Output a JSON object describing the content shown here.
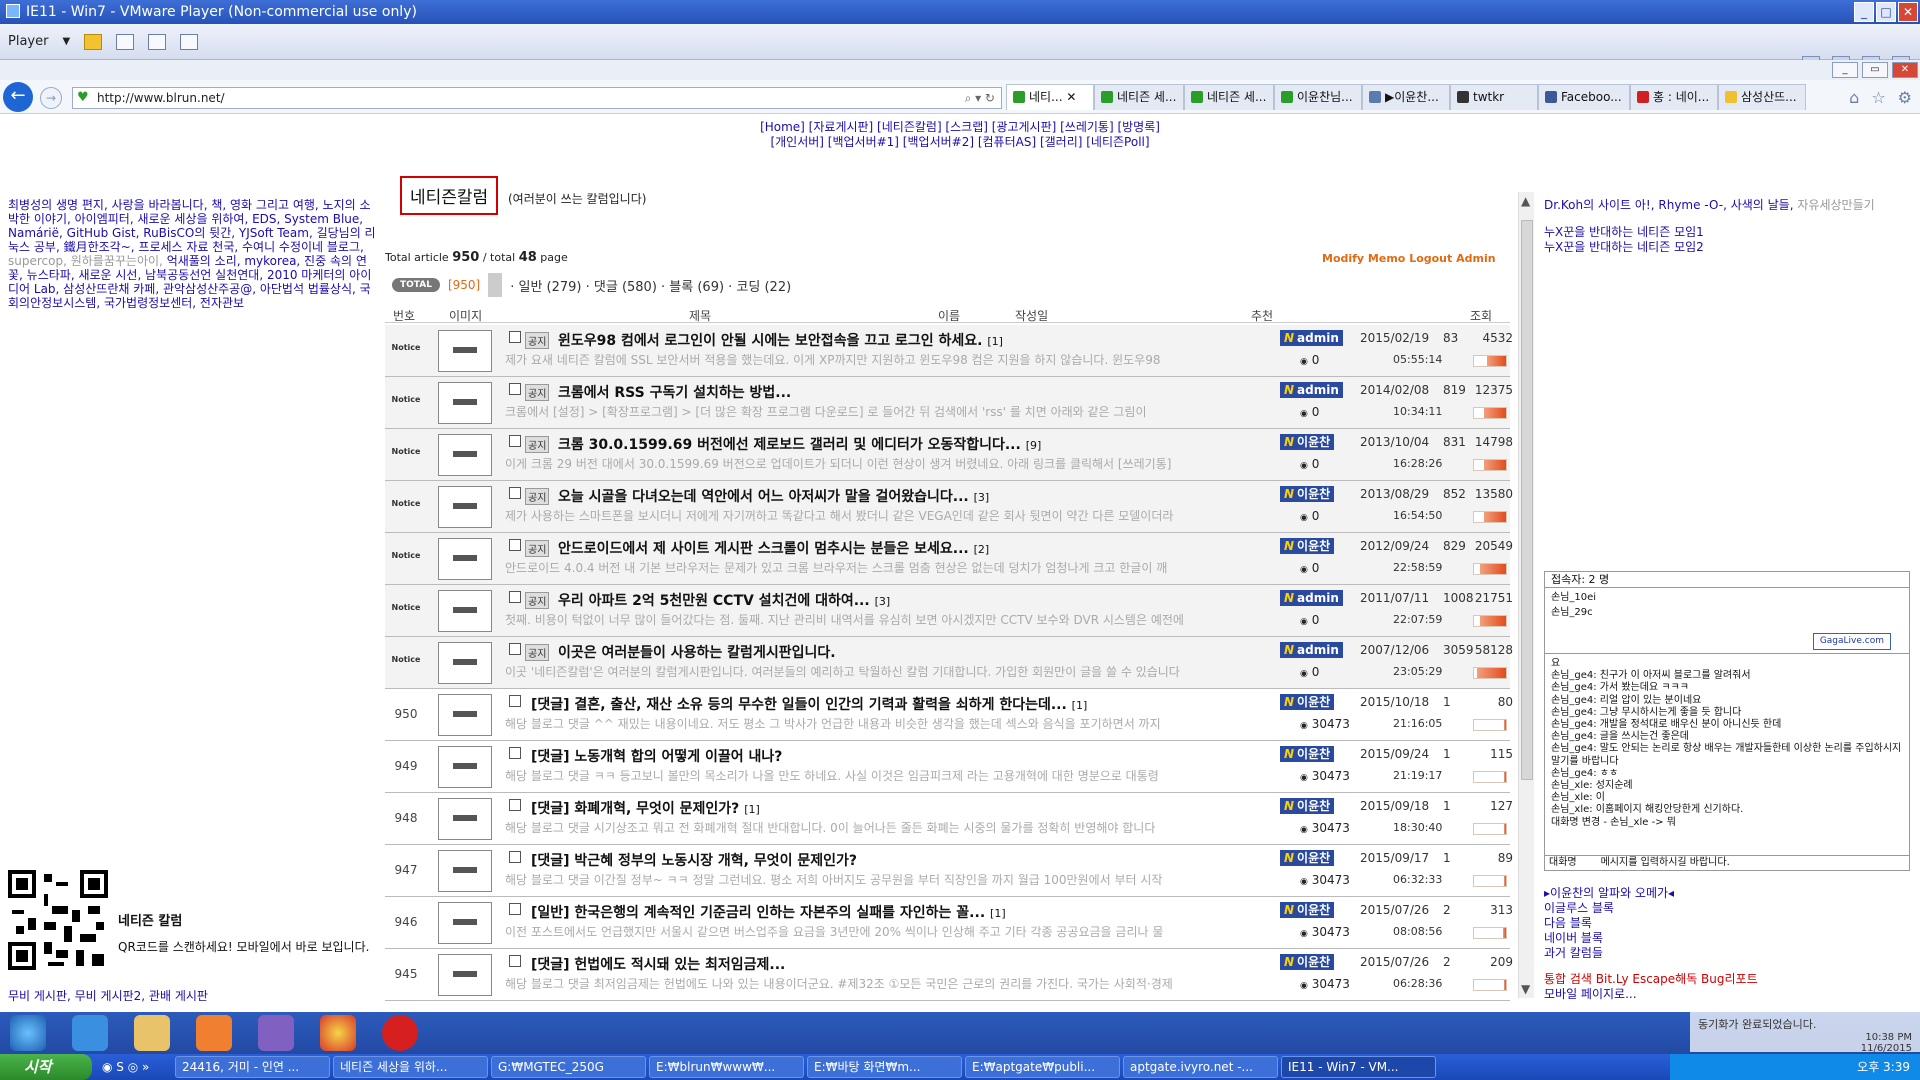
{
  "window": {
    "title": "IE11 - Win7 - VMware Player (Non-commercial use only)"
  },
  "vm_toolbar": {
    "player_label": "Player"
  },
  "browser": {
    "url": "http://www.blrun.net/",
    "tabs": [
      "네티...",
      "네티즌 세...",
      "네티즌 세...",
      "이윤찬님...",
      "▶이윤찬...",
      "twtkr",
      "Faceboo...",
      "홍 : 네이...",
      "삼성산뜨..."
    ]
  },
  "topmenu": {
    "line1": "[Home] [자료게시판] [네티즌칼럼] [스크랩] [광고게시판] [쓰레기통] [방명록]",
    "line2": "[개인서버] [백업서버#1] [백업서버#2] [컴퓨터AS] [갤러리] [네티즌Poll]"
  },
  "left_links": "최병성의 생명 편지, 사랑을 바라봅니다, 책, 영화 그리고 여행, 노지의 소박한 이야기, 아이엠피터, 새로운 세상을 위하여, EDS, System Blue, Namárië, GitHub Gist, RuBisCO의 뒷간, YJSoft Team, 길당님의 리눅스 공부, 鐵月한조각~, 프로세스 자료 천국, 수여니 수정이네 블로그,",
  "left_links_gray": "supercop, 원하를꿈꾸는아이,",
  "left_links2": "억새풀의 소리, mykorea, 진중 속의 연꽃, 뉴스타파, 새로운 시선, 남북공동선언 실천연대, 2010 마케터의 아이디어 Lab, 삼성산뜨란채 카페, 관악삼성산주공@, 아단법석 법률상식, 국회의안정보시스템, 국가법령정보센터, 전자관보",
  "qr": {
    "title": "네티즌 칼럼",
    "desc": "QR코드를 스캔하세요! 모바일에서 바로 보입니다.",
    "links": "무비 게시판, 무비 게시판2, 관배 게시판"
  },
  "board": {
    "title": "네티즌칼럼",
    "subtitle": "(여러분이 쓰는 칼럼입니다)",
    "total_label": "Total article",
    "total_articles": "950",
    "total_pages_label": "/ total",
    "total_pages": "48",
    "page_word": "page",
    "admin_links": "Modify  Memo  Logout  Admin",
    "filter_badge": "TOTAL",
    "filter_count": "[950]",
    "filters": "· 일반 (279)  · 댓글 (580)  · 블록 (69)  · 코딩 (22)",
    "headers": {
      "num": "번호",
      "image": "이미지",
      "subject": "제목",
      "name": "이름",
      "author": "작성일",
      "rec": "추천",
      "views": "조회"
    }
  },
  "rows": [
    {
      "num": "Notice",
      "tag": "공지",
      "subject": "윈도우98 컴에서 로그인이 안될 시에는 보안접속을 끄고 로그인 하세요.",
      "cmt": "[1]",
      "preview": "제가 요새 네티즌 칼럼에 SSL 보안서버 적용을 했는데요. 이게 XP까지만 지원하고 윈도우98 컴은 지원을 하지 않습니다. 윈도우98",
      "author": "admin",
      "rec": "0",
      "date": "2015/02/19",
      "time": "05:55:14",
      "cnt": "83",
      "views": "4532",
      "bar": 0.6
    },
    {
      "num": "Notice",
      "tag": "공지",
      "subject": "크롬에서 RSS 구독기 설치하는 방법...",
      "cmt": "",
      "preview": "크롬에서 [설정] > [확장프로그램] > [더 많은 확장 프로그램 다운로드] 로 들어간 뒤 검색에서 'rss' 를 치면 아래와 같은 그림이",
      "author": "admin",
      "rec": "0",
      "date": "2014/02/08",
      "time": "10:34:11",
      "cnt": "819",
      "views": "12375",
      "bar": 0.7
    },
    {
      "num": "Notice",
      "tag": "공지",
      "subject": "크롬 30.0.1599.69 버전에선 제로보드 갤러리 및 에디터가 오동작합니다...",
      "cmt": "[9]",
      "preview": "이게 크롬 29 버전 대에서 30.0.1599.69 버전으로 업데이트가 되더니 이런 현상이 생겨 버렸네요. 아래 링크를 클릭해서 [쓰레기통]",
      "author": "이윤찬",
      "rec": "0",
      "date": "2013/10/04",
      "time": "16:28:26",
      "cnt": "831",
      "views": "14798",
      "bar": 0.7
    },
    {
      "num": "Notice",
      "tag": "공지",
      "subject": "오늘 시골을 다녀오는데 역안에서 어느 아저씨가 말을 걸어왔습니다...",
      "cmt": "[3]",
      "preview": "제가 사용하는 스마트폰을 보시더니 저에게 자기꺼하고 똑같다고 해서 봤더니 같은 VEGA인데 같은 회사 뒷면이 약간 다른 모델이더라",
      "author": "이윤찬",
      "rec": "0",
      "date": "2013/08/29",
      "time": "16:54:50",
      "cnt": "852",
      "views": "13580",
      "bar": 0.7
    },
    {
      "num": "Notice",
      "tag": "공지",
      "subject": "안드로이드에서 제 사이트 게시판 스크롤이 멈추시는 분들은 보세요...",
      "cmt": "[2]",
      "preview": "안드로이드 4.0.4 버전 내 기본 브라우저는 문제가 있고 크롬 브라우저는 스크롤 멈춤 현상은 없는데 덩치가 엄청나게 크고 한글이 깨",
      "author": "이윤찬",
      "rec": "0",
      "date": "2012/09/24",
      "time": "22:58:59",
      "cnt": "829",
      "views": "20549",
      "bar": 0.8
    },
    {
      "num": "Notice",
      "tag": "공지",
      "subject": "우리 아파트 2억 5천만원 CCTV 설치건에 대하여...",
      "cmt": "[3]",
      "preview": "첫째. 비용이 턱없이 너무 많이 들어갔다는 점. 둘째. 지난 관리비 내역서를 유심히 보면 아시겠지만 CCTV 보수와 DVR 시스템은 예전에",
      "author": "admin",
      "rec": "0",
      "date": "2011/07/11",
      "time": "22:07:59",
      "cnt": "1008",
      "views": "21751",
      "bar": 0.8
    },
    {
      "num": "Notice",
      "tag": "공지",
      "subject": "이곳은 여러분들이 사용하는 칼럼게시판입니다.",
      "cmt": "",
      "preview": "이곳 '네티즌칼럼'은 여러분의 칼럼게시판입니다. 여러분들의 예리하고 탁월하신 칼럼 기대합니다. 가입한 회원만이 글을 쓸 수 있습니다",
      "author": "admin",
      "rec": "0",
      "date": "2007/12/06",
      "time": "23:05:29",
      "cnt": "3059",
      "views": "58128",
      "bar": 0.9
    },
    {
      "num": "950",
      "tag": "",
      "subject": "[댓글] 결혼, 출산, 재산 소유 등의 무수한 일들이 인간의 기력과 활력을 쇠하게 한다는데...",
      "cmt": "[1]",
      "preview": "해당 블로그 댓글 ^^ 재밌는 내용이네요. 저도 평소 그 박사가 언급한 내용과 비슷한 생각을 했는데 섹스와 음식을 포기하면서 까지",
      "author": "이윤찬",
      "rec": "30473",
      "date": "2015/10/18",
      "time": "21:16:05",
      "cnt": "1",
      "views": "80",
      "bar": 0.05
    },
    {
      "num": "949",
      "tag": "",
      "subject": "[댓글] 노동개혁 합의 어떻게 이끌어 내나?",
      "cmt": "",
      "preview": "해당 블로그 댓글 ㅋㅋ 등고보니 볼만의 목소리가 나올 만도 하네요. 사실 이것은 임금피크제 라는 고용개혁에 대한 명분으로 대통령",
      "author": "이윤찬",
      "rec": "30473",
      "date": "2015/09/24",
      "time": "21:19:17",
      "cnt": "1",
      "views": "115",
      "bar": 0.05
    },
    {
      "num": "948",
      "tag": "",
      "subject": "[댓글] 화폐개혁, 무엇이 문제인가?",
      "cmt": "[1]",
      "preview": "해당 블로그 댓글 시기상조고 뭐고 전 화폐개혁 절대 반대합니다. 0이 늘어나든 줄든 화폐는 시중의 물가를 정확히 반영해야 합니다",
      "author": "이윤찬",
      "rec": "30473",
      "date": "2015/09/18",
      "time": "18:30:40",
      "cnt": "1",
      "views": "127",
      "bar": 0.05
    },
    {
      "num": "947",
      "tag": "",
      "subject": "[댓글] 박근혜 정부의 노동시장 개혁, 무엇이 문제인가?",
      "cmt": "",
      "preview": "해당 블로그 댓글 이간질 정부~ ㅋㅋ 정말 그런네요. 평소 저희 아버지도 공무원을 부터 직장인을 까지 월급 100만원에서 부터 시작",
      "author": "이윤찬",
      "rec": "30473",
      "date": "2015/09/17",
      "time": "06:32:33",
      "cnt": "1",
      "views": "89",
      "bar": 0.05
    },
    {
      "num": "946",
      "tag": "",
      "subject": "[일반] 한국은행의 계속적인 기준금리 인하는 자본주의 실패를 자인하는 꼴...",
      "cmt": "[1]",
      "preview": "이전 포스트에서도 언급했지만 서울시 같으면 버스업주을 요금을 3년만에 20% 씩이나 인상해 주고 기타 각종 공공요금을 금리나 물",
      "author": "이윤찬",
      "rec": "30473",
      "date": "2015/07/26",
      "time": "08:08:56",
      "cnt": "2",
      "views": "313",
      "bar": 0.1
    },
    {
      "num": "945",
      "tag": "",
      "subject": "[댓글] 헌법에도 적시돼 있는 최저임금제...",
      "cmt": "",
      "preview": "해당 블로그 댓글 최저임금제는 헌법에도 나와 있는 내용이더군요. #제32조 ①모든 국민은 근로의 권리를 가진다. 국가는 사회적·경제",
      "author": "이윤찬",
      "rec": "30473",
      "date": "2015/07/26",
      "time": "06:28:36",
      "cnt": "2",
      "views": "209",
      "bar": 0.05
    }
  ],
  "right": {
    "links1": "Dr.Koh의 사이트 아!, Rhyme -O-, 사색의 날들,",
    "links1_gray": "자유세상만들기",
    "links2": "누X꾼을 반대하는 네티즌 모임1",
    "links3": "누X꾼을 반대하는 네티즌 모임2",
    "chat": {
      "header": "접속자: 2 명",
      "users": [
        "손님_10ei",
        "손님_29c"
      ],
      "gaga": "GagaLive.com",
      "msgs": [
        "요",
        "손님_ge4: 친구가 이 아저씨 블로그를 알려줘서",
        "손님_ge4: 가서 봤는데요 ㅋㅋㅋ",
        "손님_ge4: 리얼 압이 있는 분이네요",
        "손님_ge4: 그냥 무시하시는게 좋을 듯 합니다",
        "손님_ge4: 개발을 정석대로 배우신 분이 아니신듯 한데",
        "손님_ge4: 글을 쓰시는건 좋은데",
        "손님_ge4: 말도 안되는 논리로 항상 배우는 개발자들한테 이상한 논리를 주입하시지 말기를 바랍니다",
        "손님_ge4: ㅎㅎ",
        "손님_xle: 성지순례",
        "손님_xle: 이",
        "손님_xle: 이홈페이지 해킹안당한게 신기하다.",
        "대화명 변경 - 손님_xle -> 뭐"
      ],
      "input_label": "대화명",
      "input_placeholder": "메시지를 입력하시길 바랍니다."
    },
    "links4": "▸이윤찬의 알파와 오메가◂",
    "links5": "이글루스 블록",
    "links6": "다음 블록",
    "links7": "네이버 블록",
    "links8": "과거 칼럼들",
    "search": "통합 검색 Bit.Ly Escape해독 Bug리포트",
    "mobile": "모바일 페이지로..."
  },
  "taskbar": {
    "start": "시작",
    "items": [
      "24416, 거미 - 인연 ...",
      "네티즌 세상을 위하...",
      "G:₩MGTEC_250G",
      "E:₩blrun₩www₩...",
      "E:₩바탕 화면₩m...",
      "E:₩aptgate₩publi...",
      "aptgate.ivyro.net -...",
      "IE11 - Win7 - VM..."
    ],
    "clock": "오후 3:39",
    "notify": "동기화가 완료되었습니다.",
    "notify_time": "10:38 PM",
    "notify_date": "11/6/2015"
  }
}
